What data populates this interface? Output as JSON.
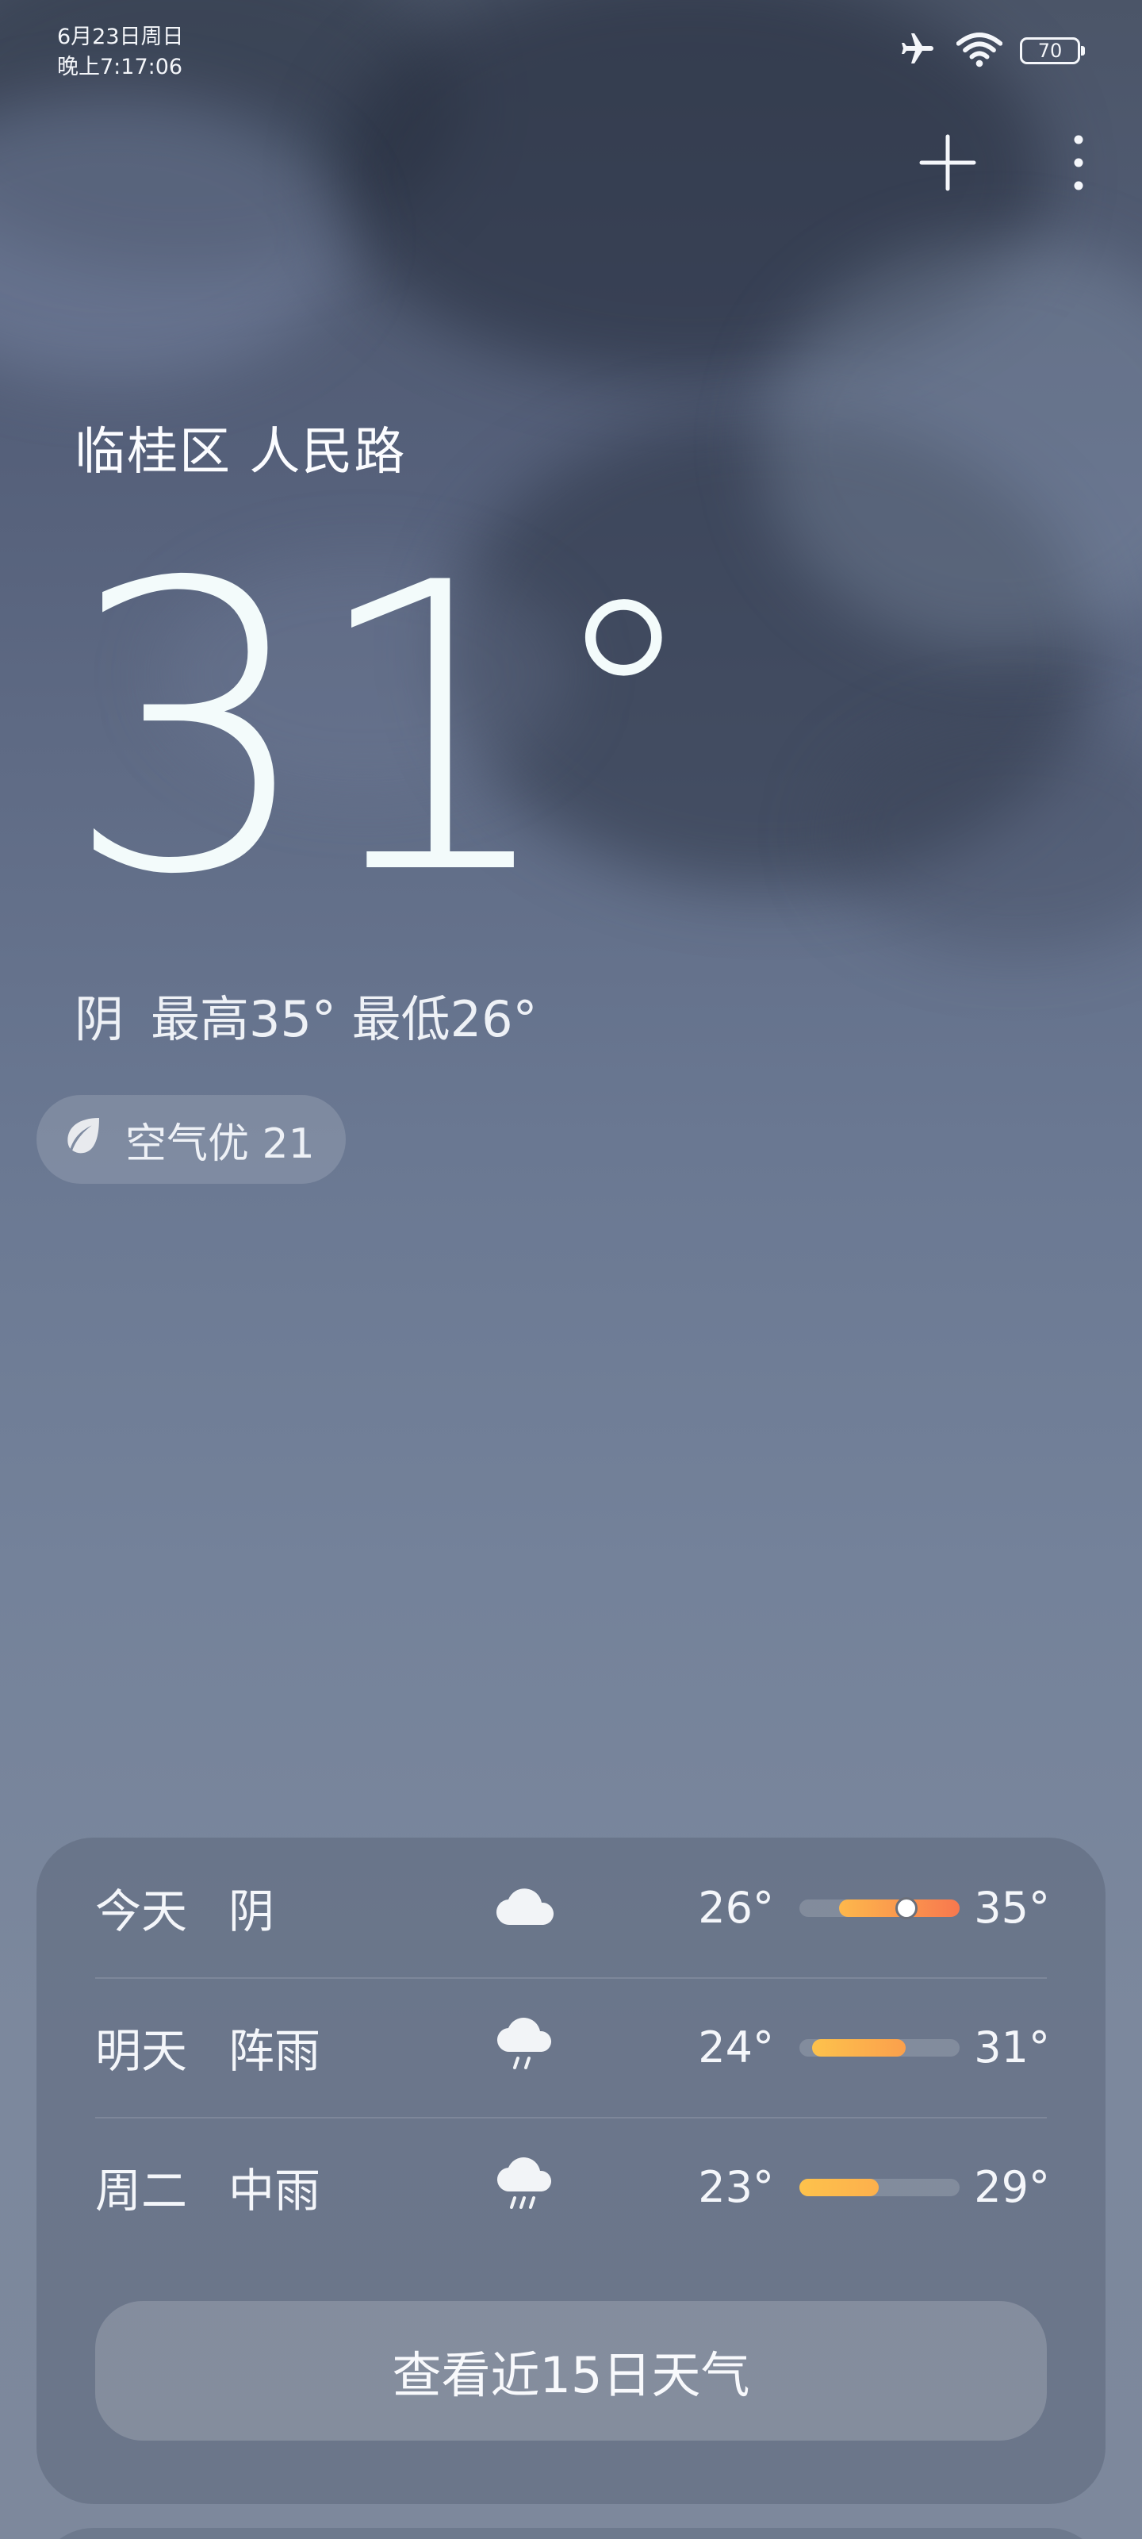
{
  "status_bar": {
    "date": "6月23日周日",
    "time": "晚上7:17:06",
    "battery": "70",
    "icons": [
      "airplane-mode-icon",
      "wifi-icon",
      "battery-icon"
    ]
  },
  "header": {
    "add_icon": "plus-icon",
    "menu_icon": "more-vertical-icon"
  },
  "current": {
    "location": "临桂区 人民路",
    "temperature": "31",
    "degree_symbol": "°",
    "condition": "阴",
    "high_low": "最高35° 最低26°"
  },
  "air_quality": {
    "label": "空气优 21",
    "icon": "leaf-icon"
  },
  "forecast": {
    "days": [
      {
        "day": "今天",
        "condition": "阴",
        "icon": "cloudy-icon",
        "low": "26°",
        "high": "35°",
        "low_value": 26,
        "high_value": 35,
        "current_value": 31
      },
      {
        "day": "明天",
        "condition": "阵雨",
        "icon": "shower-icon",
        "low": "24°",
        "high": "31°",
        "low_value": 24,
        "high_value": 31
      },
      {
        "day": "周二",
        "condition": "中雨",
        "icon": "moderate-rain-icon",
        "low": "23°",
        "high": "29°",
        "low_value": 23,
        "high_value": 29
      }
    ],
    "cta_label": "查看近15日天气"
  },
  "colors": {
    "bar_hot": "#f8784e",
    "bar_warm": "#fdb84c",
    "bar_track": "rgba(255,255,255,0.16)"
  }
}
